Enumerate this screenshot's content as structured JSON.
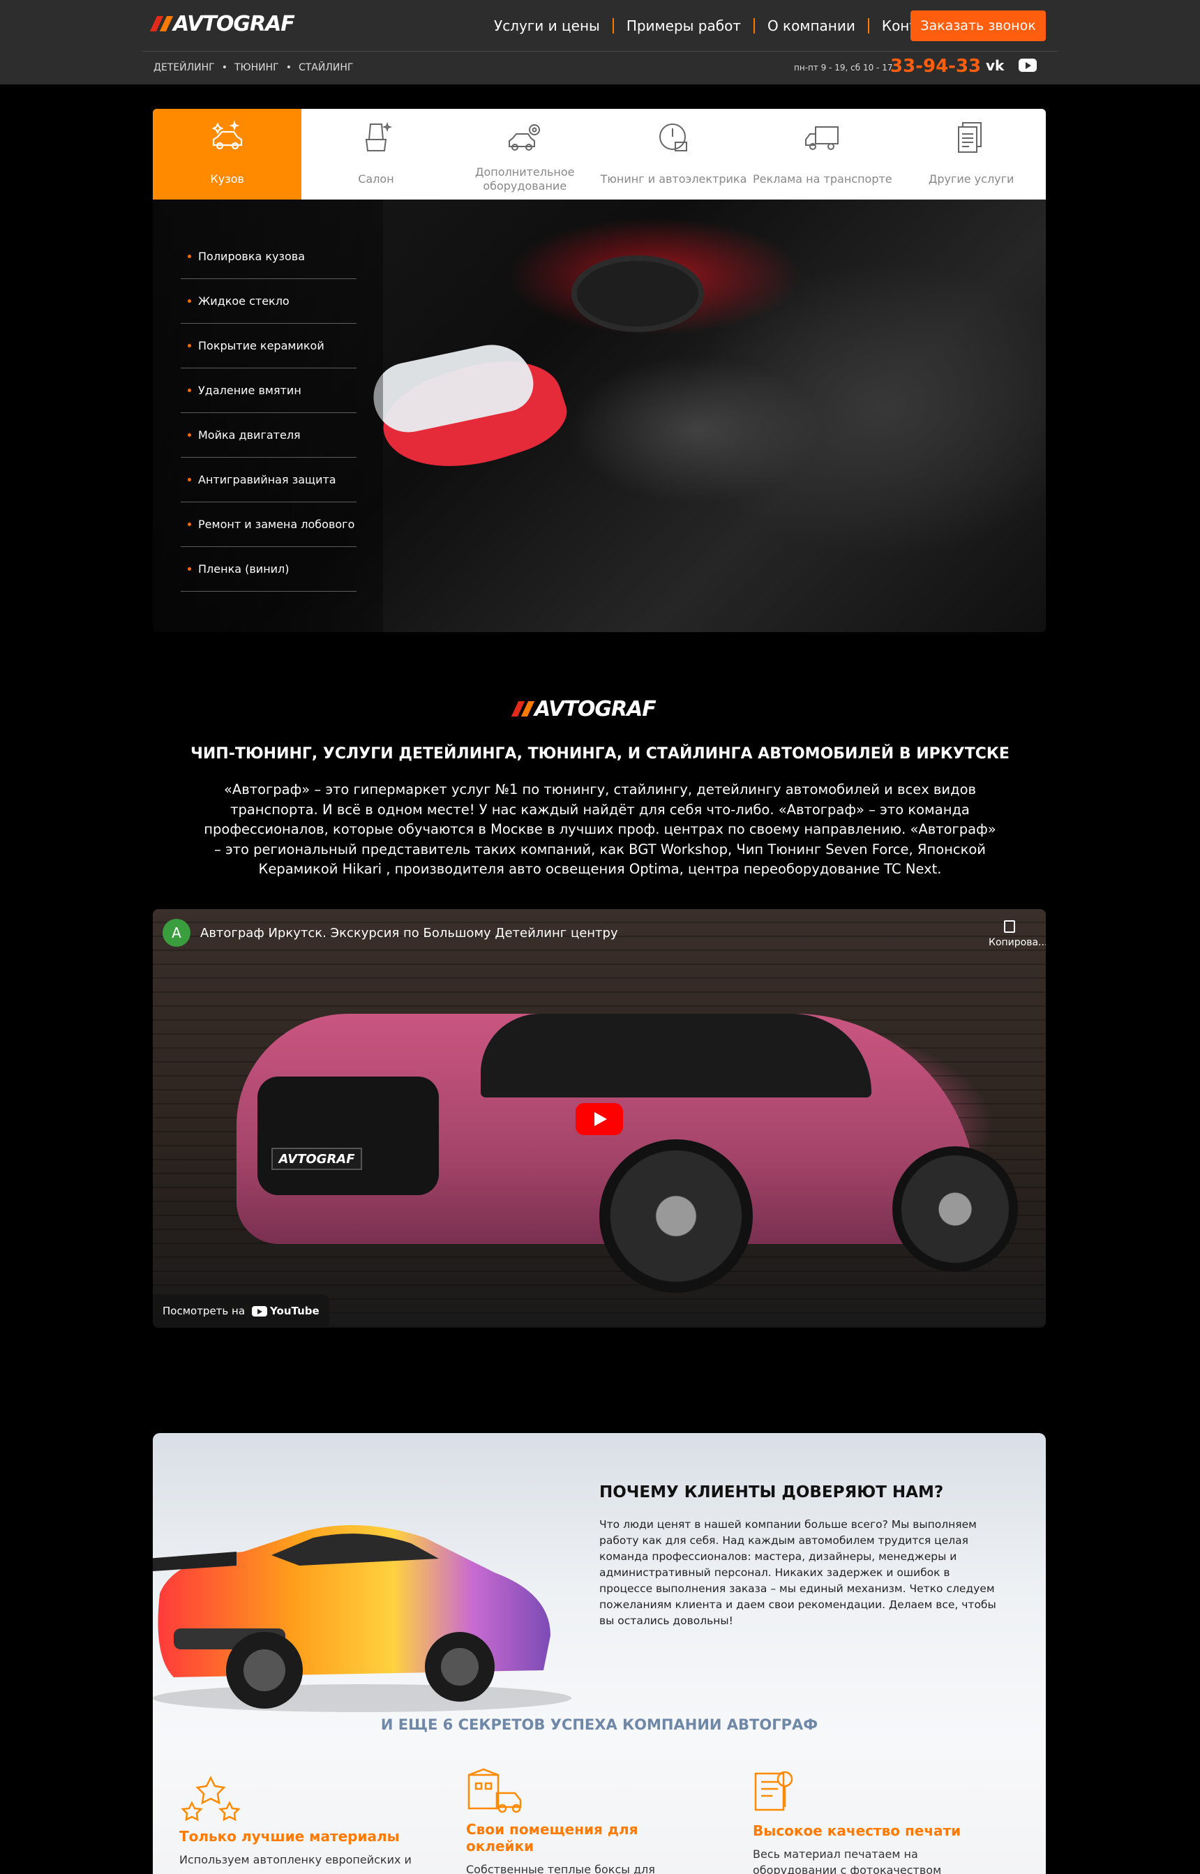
{
  "header": {
    "logo": "AVTOGRAF",
    "nav": [
      "Услуги и цены",
      "Примеры работ",
      "О компании",
      "Контакты"
    ],
    "call_button": "Заказать звонок",
    "subnav": [
      "ДЕТЕЙЛИНГ",
      "ТЮНИНГ",
      "СТАЙЛИНГ"
    ],
    "hours": "пн-пт 9 - 19, сб 10 - 17",
    "phone": "33-94-33",
    "vk_label": "vk"
  },
  "tabs": [
    {
      "label": "Кузов",
      "icon": "car-sparkle-icon",
      "active": true
    },
    {
      "label": "Салон",
      "icon": "car-seat-icon",
      "active": false
    },
    {
      "label": "Дополнительное оборудование",
      "icon": "car-gear-icon",
      "active": false
    },
    {
      "label": "Тюнинг и автоэлектрика",
      "icon": "gauge-icon",
      "active": false
    },
    {
      "label": "Реклама на транспорте",
      "icon": "truck-icon",
      "active": false
    },
    {
      "label": "Другие услуги",
      "icon": "documents-icon",
      "active": false
    }
  ],
  "services": [
    "Полировка кузова",
    "Жидкое стекло",
    "Покрытие керамикой",
    "Удаление вмятин",
    "Мойка двигателя",
    "Антигравийная защита",
    "Ремонт и замена лобового",
    "Пленка (винил)"
  ],
  "about": {
    "logo": "AVTOGRAF",
    "title": "ЧИП-ТЮНИНГ, УСЛУГИ ДЕТЕЙЛИНГА, ТЮНИНГА, И СТАЙЛИНГА АВТОМОБИЛЕЙ В ИРКУТСКЕ",
    "text": "«Автограф» – это гипермаркет услуг №1 по тюнингу, стайлингу, детейлингу автомобилей и всех видов транспорта. И всё в одном месте! У нас каждый найдёт для себя что-либо. «Автограф» – это команда профессионалов, которые обучаются в Москве в лучших проф. центрах по своему направлению. «Автограф» – это региональный представитель таких компаний, как BGT Workshop, Чип Тюнинг Seven Force, Японской Керамикой Hikari , производителя авто освещения Optima, центра переоборудование TC Next."
  },
  "video": {
    "channel_initial": "A",
    "title": "Автограф Иркутск. Экскурсия по Большому Детейлинг центру",
    "copy_label": "Копирова...",
    "watch_on": "Посмотреть на",
    "youtube": "YouTube",
    "plate": "AVTOGRAF"
  },
  "trust": {
    "title": "ПОЧЕМУ КЛИЕНТЫ ДОВЕРЯЮТ НАМ?",
    "text": "Что люди ценят в нашей компании больше всего? Мы выполняем работу как для себя. Над каждым автомобилем трудится целая команда профессионалов: мастера, дизайнеры, менеджеры и административный персонал. Никаких задержек и ошибок в процессе выполнения заказа – мы единый механизм. Четко следуем пожеланиям клиента и даем свои рекомендации. Делаем все, чтобы вы остались довольны!",
    "secrets_title": "И ЕЩЕ 6 СЕКРЕТОВ УСПЕХА КОМПАНИИ АВТОГРАФ",
    "features": [
      {
        "title": "Только лучшие материалы",
        "text": "Используем автопленку европейских и",
        "icon": "stars-award-icon"
      },
      {
        "title": "Свои помещения для оклейки",
        "text": "Собственные теплые боксы для грузовых и легковых автомобилей. Все боксы оборудованы",
        "icon": "garage-icon"
      },
      {
        "title": "Высокое качество печати",
        "text": "Весь материал печатаем на оборудовании с фотокачеством экосольвентными чернилами.",
        "icon": "print-icon"
      }
    ]
  },
  "colors": {
    "accent": "#ff7a00",
    "call": "#ff5e0e",
    "header_bg": "#2d2d2d",
    "secrets": "#6f88a8"
  }
}
